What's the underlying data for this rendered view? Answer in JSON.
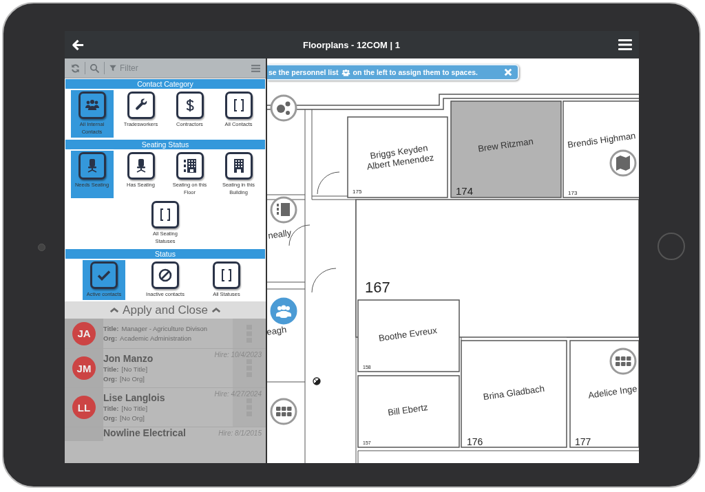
{
  "header": {
    "title": "Floorplans - 12COM | 1"
  },
  "filter_panel": {
    "search": {
      "placeholder": "Filter"
    },
    "sections": [
      {
        "title": "Contact Category",
        "items": [
          {
            "label": "All Internal Contacts",
            "kind": "people",
            "selected": true
          },
          {
            "label": "Tradesworkers",
            "kind": "wrench",
            "selected": false
          },
          {
            "label": "Contractors",
            "kind": "dollar",
            "selected": false
          },
          {
            "label": "All Contacts",
            "kind": "brackets",
            "selected": false
          }
        ]
      },
      {
        "title": "Seating Status",
        "items": [
          {
            "label": "Needs Seating",
            "kind": "chair",
            "selected": true
          },
          {
            "label": "Has Seating",
            "kind": "chair",
            "selected": false
          },
          {
            "label": "Seating on this Floor",
            "kind": "floors",
            "selected": false
          },
          {
            "label": "Seating in this Building",
            "kind": "building",
            "selected": false
          },
          {
            "label": "All Seating Statuses",
            "kind": "brackets",
            "selected": false
          }
        ]
      },
      {
        "title": "Status",
        "items": [
          {
            "label": "Active contacts",
            "kind": "check",
            "selected": true
          },
          {
            "label": "Inactive contacts",
            "kind": "blocked",
            "selected": false
          },
          {
            "label": "All Statuses",
            "kind": "brackets",
            "selected": false
          }
        ]
      }
    ],
    "apply_button": "Apply and Close"
  },
  "contacts": [
    {
      "initials": "JA",
      "color": "#cc4444",
      "title_label": "Title:",
      "title": "Manager - Agriculture Divison",
      "org_label": "Org:",
      "org": "Academic Administration"
    },
    {
      "initials": "JM",
      "color": "#cc4444",
      "name": "Jon Manzo",
      "hire": "Hire: 10/4/2023",
      "title_label": "Title:",
      "title": "[No Title]",
      "org_label": "Org:",
      "org": "[No Org]"
    },
    {
      "initials": "LL",
      "color": "#cc4444",
      "name": "Lise Langlois",
      "hire": "Hire: 4/27/2024",
      "title_label": "Title:",
      "title": "[No Title]",
      "org_label": "Org:",
      "org": "[No Org]"
    },
    {
      "name": "Nowline Electrical",
      "hire": "Hire: 8/1/2015"
    }
  ],
  "banner": {
    "text_before": "se the personnel list",
    "text_after": "on the left to assign them to spaces."
  },
  "floorplan": {
    "rooms": [
      {
        "names": [
          "Briggs Keyden",
          "Albert Menendez"
        ],
        "number": "175"
      },
      {
        "names": [
          "Brew Ritzman"
        ],
        "number": "174",
        "highlighted": true
      },
      {
        "names": [
          "Brendis Highman"
        ],
        "number": "173"
      },
      {
        "names": [
          "neally"
        ]
      },
      {
        "names": [
          "eagh"
        ]
      },
      {
        "number": "167"
      },
      {
        "names": [
          "Boothe Evreux"
        ],
        "number": "158"
      },
      {
        "names": [
          "Bill Ebertz"
        ],
        "number": "157"
      },
      {
        "names": [
          "Brina Gladbach"
        ],
        "number": "176"
      },
      {
        "names": [
          "Adelice Inge"
        ],
        "number": "177"
      }
    ],
    "markers": [
      {
        "kind": "gear",
        "selected": false
      },
      {
        "kind": "floors",
        "selected": false
      },
      {
        "kind": "people",
        "selected": true
      },
      {
        "kind": "grid",
        "selected": false
      },
      {
        "kind": "map",
        "selected": false
      },
      {
        "kind": "grid",
        "selected": false
      }
    ]
  }
}
